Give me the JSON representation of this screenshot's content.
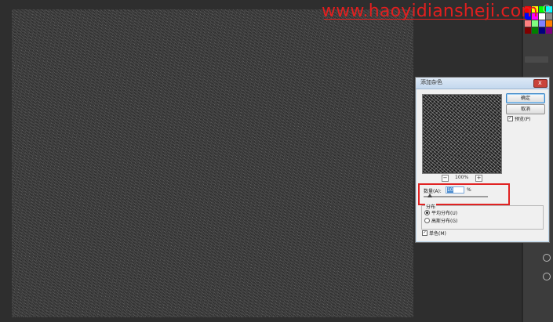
{
  "watermark": {
    "url": "www.haoyidiansheji.com"
  },
  "dialog": {
    "title": "添加杂色",
    "close_label": "x",
    "ok_label": "确定",
    "cancel_label": "取消",
    "preview_label": "预览(P)",
    "preview_checked": "✓",
    "zoom_out": "−",
    "zoom_level": "100%",
    "zoom_in": "+",
    "amount_label": "数量(A):",
    "amount_value": "10",
    "amount_unit": "%",
    "distribution_title": "分布",
    "uniform_label": "平均分布(U)",
    "gaussian_label": "高斯分布(G)",
    "mono_label": "单色(M)",
    "mono_checked": "✓"
  },
  "colors": {
    "highlight": "#e12323",
    "watermark": "#e21f1f",
    "canvas": "#3a3a3a"
  }
}
